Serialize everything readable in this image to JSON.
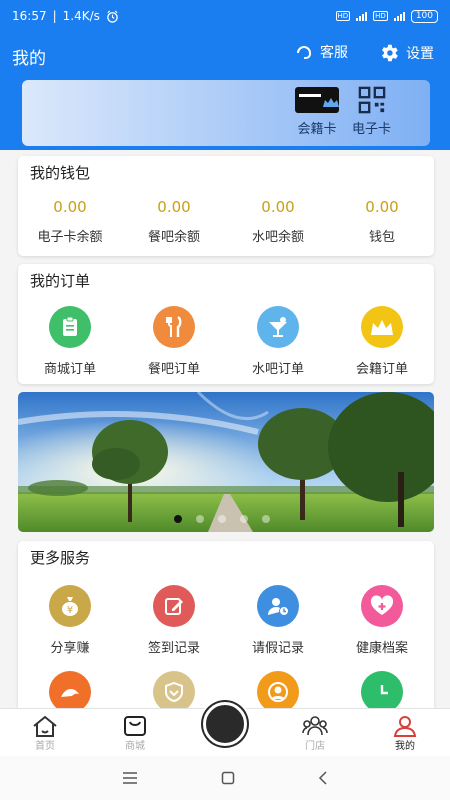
{
  "status_bar": {
    "time": "16:57",
    "network_speed": "1.4K/s",
    "battery": "100"
  },
  "header": {
    "title": "我的",
    "service_label": "客服",
    "settings_label": "设置"
  },
  "cards": {
    "member_card_label": "会籍卡",
    "e_card_label": "电子卡"
  },
  "wallet": {
    "title": "我的钱包",
    "items": [
      {
        "value": "0.00",
        "label": "电子卡余额"
      },
      {
        "value": "0.00",
        "label": "餐吧余额"
      },
      {
        "value": "0.00",
        "label": "水吧余额"
      },
      {
        "value": "0.00",
        "label": "钱包"
      }
    ]
  },
  "orders": {
    "title": "我的订单",
    "items": [
      {
        "label": "商城订单",
        "icon": "clipboard-icon",
        "color": "#3fbf6a"
      },
      {
        "label": "餐吧订单",
        "icon": "fork-knife-icon",
        "color": "#f08a3c"
      },
      {
        "label": "水吧订单",
        "icon": "drink-icon",
        "color": "#5fb4ec"
      },
      {
        "label": "会籍订单",
        "icon": "crown-icon",
        "color": "#f2c414"
      }
    ]
  },
  "banner": {
    "slide_count": 5,
    "active_slide": 1
  },
  "services": {
    "title": "更多服务",
    "items": [
      {
        "label": "分享赚",
        "icon": "money-bag-icon",
        "color": "#c9a84a"
      },
      {
        "label": "签到记录",
        "icon": "edit-icon",
        "color": "#e05a5a"
      },
      {
        "label": "请假记录",
        "icon": "user-time-icon",
        "color": "#3f8fe0"
      },
      {
        "label": "健康档案",
        "icon": "health-icon",
        "color": "#f25a9a"
      }
    ],
    "partial_row_icons": [
      {
        "icon": "muscle-icon",
        "color": "#f0702a"
      },
      {
        "icon": "shield-icon",
        "color": "#d8c48a"
      },
      {
        "icon": "person-icon",
        "color": "#f29a1a"
      },
      {
        "icon": "clock-icon",
        "color": "#2ebd6a"
      }
    ]
  },
  "bottom_nav": {
    "items": [
      {
        "label": "首页",
        "icon": "home-icon"
      },
      {
        "label": "商城",
        "icon": "bag-icon"
      },
      {
        "label": "",
        "icon": "camera-button-icon"
      },
      {
        "label": "门店",
        "icon": "store-icon"
      },
      {
        "label": "我的",
        "icon": "user-icon"
      }
    ],
    "active": "我的"
  },
  "colors": {
    "primary": "#1a7ef0",
    "gold": "#c9a017",
    "active_nav": "#d6423b"
  }
}
